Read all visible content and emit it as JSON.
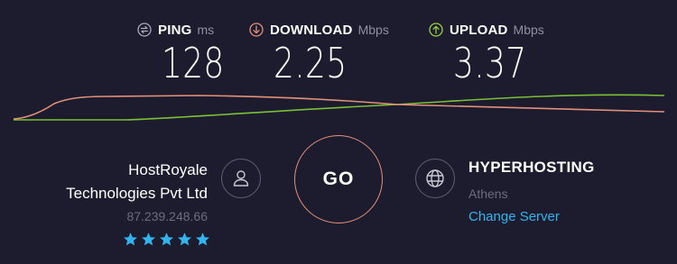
{
  "metrics": {
    "ping": {
      "label": "PING",
      "unit": "ms",
      "value": "128",
      "icon": "ping-icon",
      "color": "#a9a9b8"
    },
    "download": {
      "label": "DOWNLOAD",
      "unit": "Mbps",
      "value": "2.25",
      "icon": "download-arrow-icon",
      "color": "#e3907a"
    },
    "upload": {
      "label": "UPLOAD",
      "unit": "Mbps",
      "value": "3.37",
      "icon": "upload-arrow-icon",
      "color": "#9ad13f"
    }
  },
  "isp": {
    "name_line1": "HostRoyale",
    "name_line2": "Technologies Pvt Ltd",
    "ip": "87.239.248.66",
    "rating": 5,
    "rating_max": 5,
    "icon": "user-icon"
  },
  "go_button": {
    "label": "GO",
    "color": "#e3907a"
  },
  "server": {
    "name": "HYPERHOSTING",
    "location": "Athens",
    "change_label": "Change Server",
    "icon": "globe-icon"
  },
  "colors": {
    "background": "#1c1c2e",
    "link": "#33b4ef",
    "star": "#33b4ef"
  }
}
